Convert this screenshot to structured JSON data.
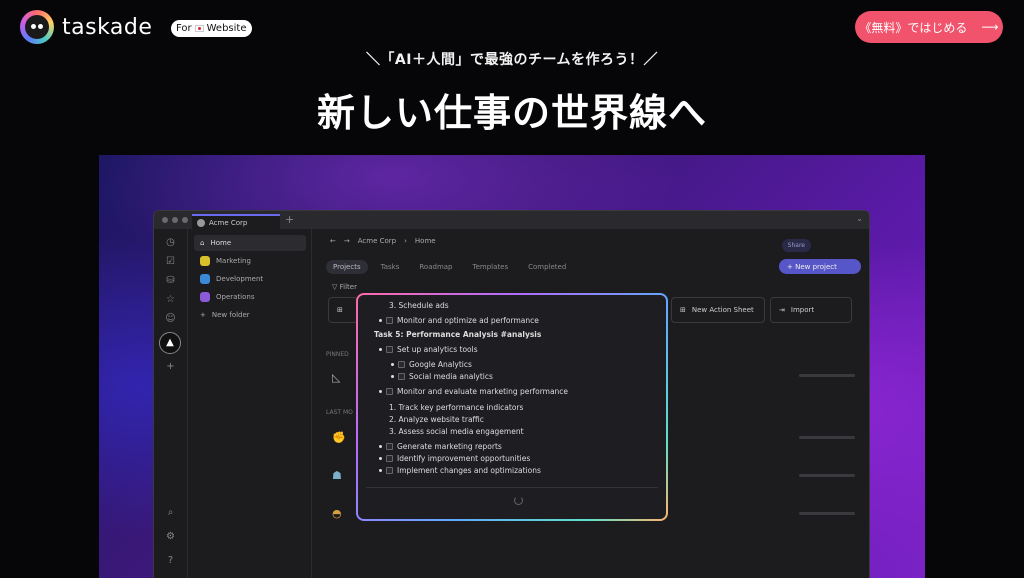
{
  "brand": {
    "name": "taskade",
    "badge": "For",
    "badge_suffix": "Website"
  },
  "cta": {
    "label": "《無料》ではじめる",
    "arrow": "⟶"
  },
  "hero": {
    "tagline": "＼「AI＋人間」で最強のチームを作ろう！／",
    "headline": "新しい仕事の世界線へ"
  },
  "app": {
    "tab_label": "Acme Corp",
    "sidebar": [
      {
        "label": "Home",
        "color": "#888888"
      },
      {
        "label": "Marketing",
        "color": "#d9c229"
      },
      {
        "label": "Development",
        "color": "#3a8ad8"
      },
      {
        "label": "Operations",
        "color": "#8a5ad8"
      },
      {
        "label": "New folder",
        "color": "#555555"
      }
    ],
    "breadcrumb": {
      "workspace": "Acme Corp",
      "page": "Home"
    },
    "tabs": [
      "Projects",
      "Tasks",
      "Roadmap",
      "Templates",
      "Completed"
    ],
    "share_label": "Share",
    "new_project_label": "+ New project",
    "filter_label": "Filter",
    "cards": [
      "New Action Sheet",
      "Import"
    ],
    "section_pinned": "PINNED",
    "section_last": "LAST MO",
    "popup": {
      "lines": [
        {
          "text": "3. Schedule ads",
          "kind": "num"
        },
        {
          "text": "Monitor and optimize ad performance",
          "kind": "task"
        },
        {
          "text": "Task 5: Performance Analysis #analysis",
          "kind": "heading"
        },
        {
          "text": "Set up analytics tools",
          "kind": "task"
        },
        {
          "text": "Google Analytics",
          "kind": "subtask"
        },
        {
          "text": "Social media analytics",
          "kind": "subtask"
        },
        {
          "text": "Monitor and evaluate marketing performance",
          "kind": "task"
        },
        {
          "text": "1. Track key performance indicators",
          "kind": "num"
        },
        {
          "text": "2. Analyze website traffic",
          "kind": "num"
        },
        {
          "text": "3. Assess social media engagement",
          "kind": "num"
        },
        {
          "text": "Generate marketing reports",
          "kind": "task"
        },
        {
          "text": "Identify improvement opportunities",
          "kind": "task"
        },
        {
          "text": "Implement changes and optimizations",
          "kind": "task"
        }
      ]
    }
  }
}
